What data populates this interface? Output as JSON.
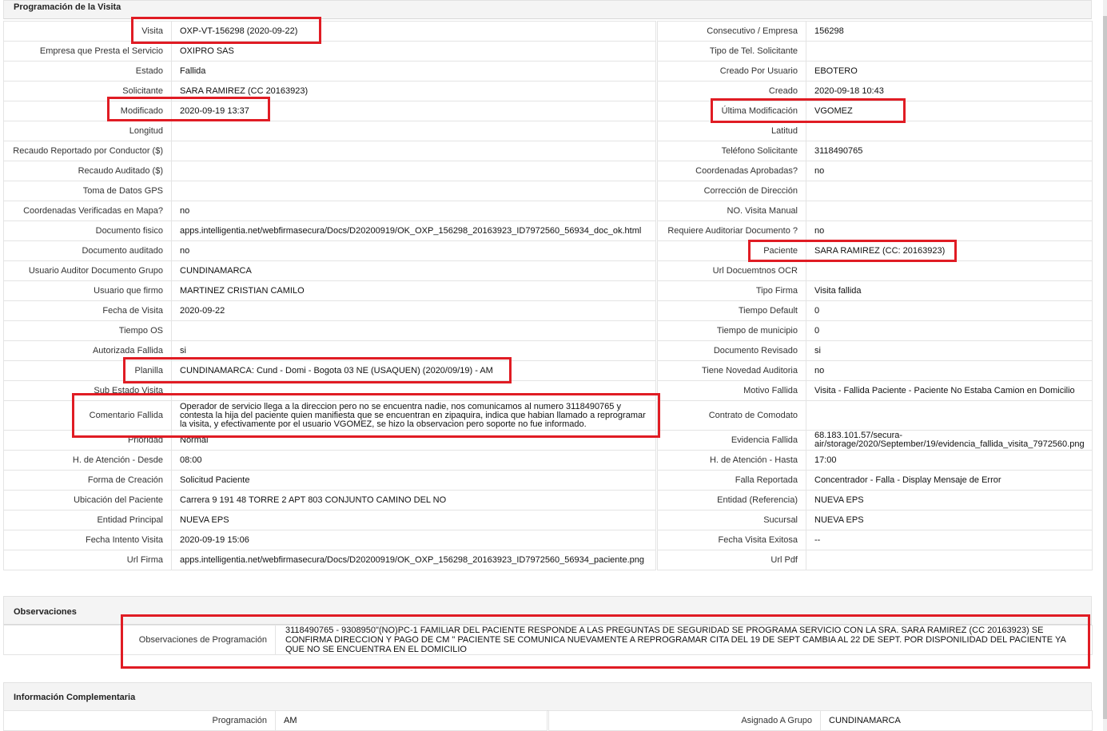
{
  "section_programacion": {
    "title": "Programación de la Visita",
    "rows": [
      {
        "l1": "Visita",
        "v1": "OXP-VT-156298 (2020-09-22)",
        "l2": "Consecutivo / Empresa",
        "v2": "156298"
      },
      {
        "l1": "Empresa que Presta el Servicio",
        "v1": "OXIPRO SAS",
        "l2": "Tipo de Tel. Solicitante",
        "v2": ""
      },
      {
        "l1": "Estado",
        "v1": "Fallida",
        "l2": "Creado Por Usuario",
        "v2": "EBOTERO"
      },
      {
        "l1": "Solicitante",
        "v1": "SARA RAMIREZ (CC 20163923)",
        "l2": "Creado",
        "v2": "2020-09-18 10:43"
      },
      {
        "l1": "Modificado",
        "v1": "2020-09-19 13:37",
        "l2": "Última Modificación",
        "v2": "VGOMEZ"
      },
      {
        "l1": "Longitud",
        "v1": "",
        "l2": "Latitud",
        "v2": ""
      },
      {
        "l1": "Recaudo Reportado por Conductor ($)",
        "v1": "",
        "l2": "Teléfono Solicitante",
        "v2": "3118490765"
      },
      {
        "l1": "Recaudo Auditado ($)",
        "v1": "",
        "l2": "Coordenadas Aprobadas?",
        "v2": "no"
      },
      {
        "l1": "Toma de Datos GPS",
        "v1": "",
        "l2": "Corrección de Dirección",
        "v2": ""
      },
      {
        "l1": "Coordenadas Verificadas en Mapa?",
        "v1": "no",
        "l2": "NO. Visita Manual",
        "v2": ""
      },
      {
        "l1": "Documento fisico",
        "v1": "apps.intelligentia.net/webfirmasecura/Docs/D20200919/OK_OXP_156298_20163923_ID7972560_56934_doc_ok.html",
        "l2": "Requiere Auditoriar Documento ?",
        "v2": "no"
      },
      {
        "l1": "Documento auditado",
        "v1": "no",
        "l2": "Paciente",
        "v2": "SARA RAMIREZ (CC: 20163923)"
      },
      {
        "l1": "Usuario Auditor Documento Grupo",
        "v1": "CUNDINAMARCA",
        "l2": "Url Docuemtnos OCR",
        "v2": ""
      },
      {
        "l1": "Usuario que firmo",
        "v1": "MARTINEZ CRISTIAN CAMILO",
        "l2": "Tipo Firma",
        "v2": "Visita fallida"
      },
      {
        "l1": "Fecha de Visita",
        "v1": "2020-09-22",
        "l2": "Tiempo Default",
        "v2": "0"
      },
      {
        "l1": "Tiempo OS",
        "v1": "",
        "l2": "Tiempo de municipio",
        "v2": "0"
      },
      {
        "l1": "Autorizada Fallida",
        "v1": "si",
        "l2": "Documento Revisado",
        "v2": "si"
      },
      {
        "l1": "Planilla",
        "v1": "CUNDINAMARCA: Cund - Domi - Bogota 03 NE (USAQUEN) (2020/09/19) - AM",
        "l2": "Tiene Novedad Auditoria",
        "v2": "no"
      },
      {
        "l1": "Sub Estado Visita",
        "v1": "",
        "l2": "Motivo Fallida",
        "v2": "Visita - Fallida Paciente - Paciente No Estaba Camion en Domicilio"
      },
      {
        "l1": "Comentario Fallida",
        "v1": "Operador de servicio llega a la direccion pero no se encuentra nadie, nos comunicamos al numero 3118490765 y contesta la hija del paciente quien manifiesta que se encuentran en zipaquira, indica que habian llamado a reprogramar la visita, y efectivamente por el usuario VGOMEZ, se hizo la observacion pero soporte no fue informado.",
        "l2": "Contrato de Comodato",
        "v2": ""
      },
      {
        "l1": "Prioridad",
        "v1": "Normal",
        "l2": "Evidencia Fallida",
        "v2": "68.183.101.57/secura-air/storage/2020/September/19/evidencia_fallida_visita_7972560.png"
      },
      {
        "l1": "H. de Atención - Desde",
        "v1": "08:00",
        "l2": "H. de Atención - Hasta",
        "v2": "17:00"
      },
      {
        "l1": "Forma de Creación",
        "v1": "Solicitud Paciente",
        "l2": "Falla Reportada",
        "v2": "Concentrador - Falla - Display Mensaje de Error"
      },
      {
        "l1": "Ubicación del Paciente",
        "v1": "Carrera 9 191 48 TORRE 2 APT 803 CONJUNTO CAMINO DEL NO",
        "l2": "Entidad (Referencia)",
        "v2": "NUEVA EPS"
      },
      {
        "l1": "Entidad Principal",
        "v1": "NUEVA EPS",
        "l2": "Sucursal",
        "v2": "NUEVA EPS"
      },
      {
        "l1": "Fecha Intento Visita",
        "v1": "2020-09-19 15:06",
        "l2": "Fecha Visita Exitosa",
        "v2": "--"
      },
      {
        "l1": "Url Firma",
        "v1": "apps.intelligentia.net/webfirmasecura/Docs/D20200919/OK_OXP_156298_20163923_ID7972560_56934_paciente.png",
        "l2": "Url Pdf",
        "v2": ""
      }
    ]
  },
  "section_observaciones": {
    "title": "Observaciones",
    "label": "Observaciones de Programación",
    "value": "3118490765 - 9308950\"(NO)PC-1 FAMILIAR DEL PACIENTE RESPONDE A LAS PREGUNTAS DE SEGURIDAD SE PROGRAMA SERVICIO CON LA SRA. SARA RAMIREZ (CC 20163923) SE CONFIRMA DIRECCION Y PAGO DE CM \" PACIENTE SE COMUNICA NUEVAMENTE A REPROGRAMAR CITA DEL 19 DE SEPT CAMBIA AL 22 DE SEPT. POR DISPONILIDAD DEL PACIENTE YA QUE NO SE ENCUENTRA EN EL DOMICILIO"
  },
  "section_complementaria": {
    "title": "Información Complementaria",
    "l1": "Programación",
    "v1": "AM",
    "l2": "Asignado A Grupo",
    "v2": "CUNDINAMARCA"
  },
  "colors": {
    "highlight": "#e01c24"
  }
}
